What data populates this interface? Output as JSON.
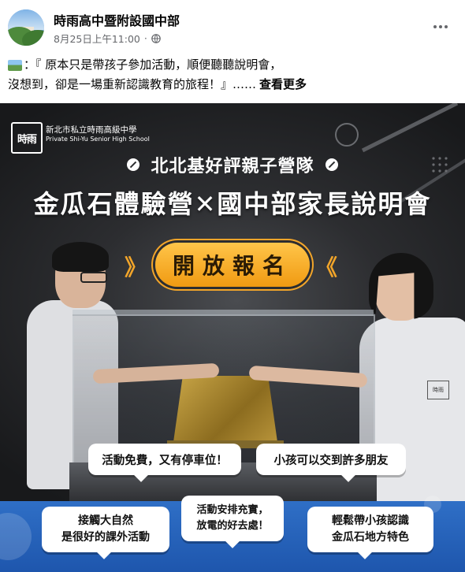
{
  "post": {
    "page_name": "時雨高中暨附設國中部",
    "timestamp": "8月25日上午11:00",
    "separator": "·",
    "audience_icon": "globe-icon",
    "more_icon": "more-horizontal-icon"
  },
  "caption": {
    "emoji": "national-park-emoji",
    "line1": "：『 原本只是帶孩子參加活動，順便聽聽說明會，",
    "line2": "沒想到，卻是一場重新認識教育的旅程！』……",
    "see_more": "查看更多"
  },
  "poster": {
    "school_logo_text": "時雨",
    "school_name_zh": "新北市私立時雨高級中學",
    "school_name_en": "Private Shi-Yu Senior High School",
    "subtitle": "北北基好評親子營隊",
    "headline": "金瓜石體驗營✕國中部家長說明會",
    "cta": "開放報名",
    "chevron_left": "》",
    "chevron_right": "《",
    "uniform_badge": "時雨",
    "bubbles": [
      {
        "lines": [
          "活動免費，又有停車位！"
        ]
      },
      {
        "lines": [
          "小孩可以交到許多朋友"
        ]
      },
      {
        "lines": [
          "活動安排充實，",
          "放電的好去處！"
        ]
      },
      {
        "lines": [
          "接觸大自然",
          "是很好的課外活動"
        ]
      },
      {
        "lines": [
          "輕鬆帶小孩認識",
          "金瓜石地方特色"
        ]
      }
    ],
    "colors": {
      "accent_orange": "#f2a52a",
      "band_blue": "#2f6fc6",
      "background_dark": "#2c2d30"
    }
  }
}
